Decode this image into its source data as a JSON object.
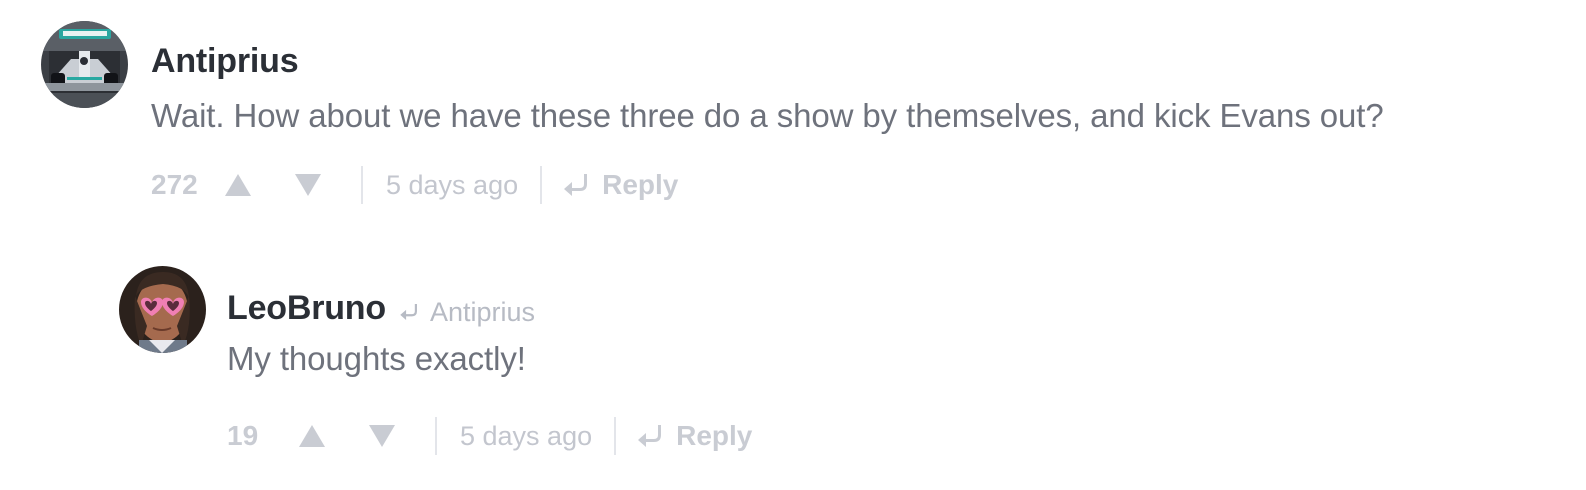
{
  "comments": [
    {
      "author": "Antiprius",
      "text": "Wait. How about we have these three do a show by themselves, and kick Evans out?",
      "score": "272",
      "time": "5 days ago",
      "reply_label": "Reply",
      "avatar_icon": "race-car-avatar"
    },
    {
      "author": "LeoBruno",
      "reply_to": "Antiprius",
      "text": "My thoughts exactly!",
      "score": "19",
      "time": "5 days ago",
      "reply_label": "Reply",
      "avatar_icon": "person-heart-glasses-avatar"
    }
  ],
  "colors": {
    "author": "#2b2f36",
    "text": "#6e727c",
    "meta": "#c9ccd3",
    "separator": "#e3e5ea"
  }
}
